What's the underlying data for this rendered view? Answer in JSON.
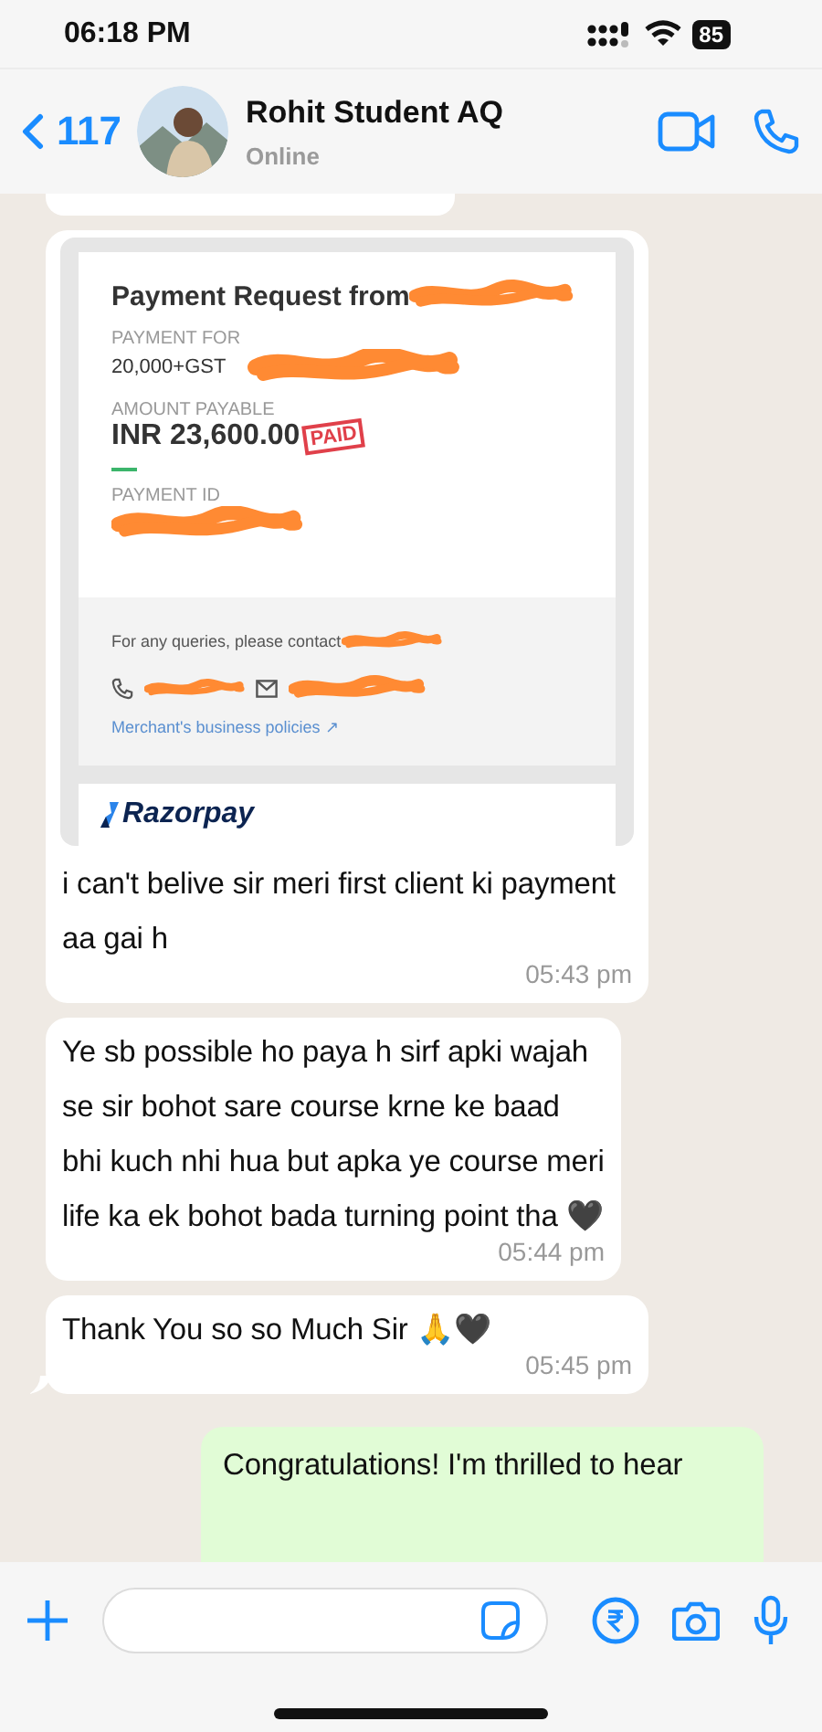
{
  "status_bar": {
    "time": "06:18 PM",
    "battery": "85"
  },
  "header": {
    "back_count": "117",
    "contact_name": "Rohit Student AQ",
    "presence": "Online"
  },
  "messages": [
    {
      "kind": "payment",
      "sent": false,
      "card": {
        "title": "Payment Request from",
        "for_label": "PAYMENT FOR",
        "for_value": "20,000+GST",
        "amount_label": "AMOUNT PAYABLE",
        "amount": "INR 23,600.00",
        "stamp": "PAID",
        "id_label": "PAYMENT ID",
        "contact_text": "For any queries, please contact",
        "policies_link": "Merchant's business policies ↗",
        "brand": "Razorpay"
      },
      "text": "i can't belive sir meri first client ki payment aa gai h",
      "time": "05:43 pm"
    },
    {
      "kind": "text",
      "sent": false,
      "text": "Ye sb possible ho paya h sirf apki wajah se sir bohot sare course krne ke baad bhi kuch nhi hua but apka ye course meri life ka ek bohot bada turning point tha 🖤",
      "time": "05:44 pm"
    },
    {
      "kind": "text",
      "sent": false,
      "text": "Thank You so so Much Sir 🙏🖤",
      "time": "05:45 pm",
      "tail": true
    },
    {
      "kind": "text",
      "sent": true,
      "text": "Congratulations! I'm thrilled to hear"
    }
  ]
}
